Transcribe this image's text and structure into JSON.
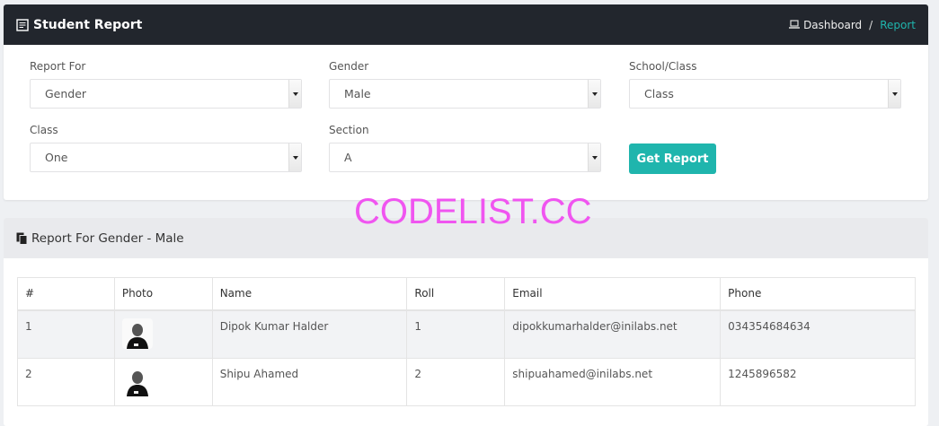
{
  "header": {
    "title": "Student Report",
    "breadcrumb": {
      "dashboard": "Dashboard",
      "separator": "/",
      "current": "Report"
    }
  },
  "form": {
    "report_for": {
      "label": "Report For",
      "value": "Gender"
    },
    "gender": {
      "label": "Gender",
      "value": "Male"
    },
    "school_class": {
      "label": "School/Class",
      "value": "Class"
    },
    "class": {
      "label": "Class",
      "value": "One"
    },
    "section": {
      "label": "Section",
      "value": "A"
    },
    "submit_label": "Get Report"
  },
  "watermark": "CODELIST.CC",
  "report": {
    "title": "Report For Gender - Male",
    "columns": [
      "#",
      "Photo",
      "Name",
      "Roll",
      "Email",
      "Phone"
    ],
    "rows": [
      {
        "num": "1",
        "name": "Dipok Kumar Halder",
        "roll": "1",
        "email": "dipokkumarhalder@inilabs.net",
        "phone": "034354684634"
      },
      {
        "num": "2",
        "name": "Shipu Ahamed",
        "roll": "2",
        "email": "shipuahamed@inilabs.net",
        "phone": "1245896582"
      }
    ]
  },
  "colors": {
    "accent": "#1fb5ad",
    "header_bg": "#22262d",
    "watermark": "#f055f0"
  }
}
